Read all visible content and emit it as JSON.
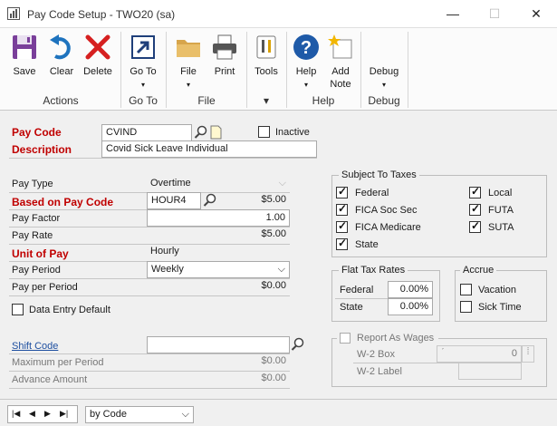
{
  "window": {
    "title": "Pay Code Setup  -  TWO20 (sa)",
    "minimize": "—",
    "maximize": "☐",
    "close": "✕"
  },
  "ribbon": {
    "buttons": {
      "save": "Save",
      "clear": "Clear",
      "delete": "Delete",
      "goto": "Go To",
      "file": "File",
      "print": "Print",
      "tools": "Tools",
      "help": "Help",
      "add_note_1": "Add",
      "add_note_2": "Note",
      "debug": "Debug"
    },
    "groups": {
      "actions": "Actions",
      "goto": "Go To",
      "file": "File",
      "help": "Help",
      "debug": "Debug"
    },
    "caret": "▾"
  },
  "form": {
    "pay_code": {
      "label": "Pay Code",
      "value": "CVIND"
    },
    "inactive": {
      "label": "Inactive",
      "checked": false
    },
    "description": {
      "label": "Description",
      "value": "Covid Sick Leave Individual"
    },
    "pay_type": {
      "label": "Pay Type",
      "value": "Overtime"
    },
    "based_on": {
      "label": "Based on Pay Code",
      "value": "HOUR4",
      "amount": "$5.00"
    },
    "pay_factor": {
      "label": "Pay Factor",
      "value": "1.00"
    },
    "pay_rate": {
      "label": "Pay Rate",
      "value": "$5.00"
    },
    "unit_of_pay": {
      "label": "Unit of Pay",
      "value": "Hourly"
    },
    "pay_period": {
      "label": "Pay Period",
      "value": "Weekly"
    },
    "pay_per_period": {
      "label": "Pay per Period",
      "value": "$0.00"
    },
    "data_entry_default": {
      "label": "Data Entry Default",
      "checked": false
    },
    "shift_code": {
      "label": "Shift Code",
      "value": ""
    },
    "max_per_period": {
      "label": "Maximum per Period",
      "value": "$0.00"
    },
    "advance_amount": {
      "label": "Advance Amount",
      "value": "$0.00"
    }
  },
  "taxes": {
    "title": "Subject To Taxes",
    "federal": "Federal",
    "fica_soc_sec": "FICA Soc Sec",
    "fica_medicare": "FICA Medicare",
    "state": "State",
    "local": "Local",
    "futa": "FUTA",
    "suta": "SUTA"
  },
  "flat_tax": {
    "title": "Flat Tax Rates",
    "federal_label": "Federal",
    "federal_value": "0.00%",
    "state_label": "State",
    "state_value": "0.00%"
  },
  "accrue": {
    "title": "Accrue",
    "vacation": "Vacation",
    "sick_time": "Sick Time"
  },
  "wages": {
    "title": "Report As Wages",
    "w2_box": "W-2 Box",
    "w2_box_value": "0",
    "w2_label": "W-2 Label"
  },
  "footer": {
    "sort": "by Code"
  }
}
